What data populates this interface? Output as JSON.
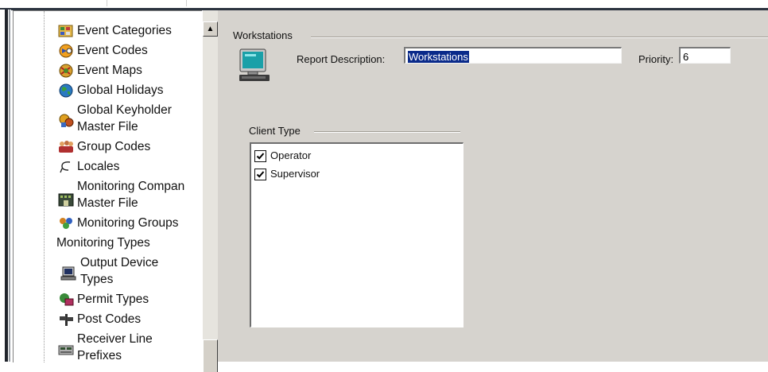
{
  "tree": {
    "items": [
      {
        "icon": "folder-tags-icon",
        "label": "Event Categories"
      },
      {
        "icon": "event-codes-icon",
        "label": "Event Codes"
      },
      {
        "icon": "event-maps-icon",
        "label": "Event Maps"
      },
      {
        "icon": "globe-icon",
        "label": "Global Holidays"
      },
      {
        "icon": "keyholder-icon",
        "label_line1": "Global Keyholder",
        "label_line2": "Master File"
      },
      {
        "icon": "group-people-icon",
        "label": "Group Codes"
      },
      {
        "icon": "locale-icon",
        "label": "Locales"
      },
      {
        "icon": "building-icon",
        "label_line1": "Monitoring Compan",
        "label_line2": "Master File"
      },
      {
        "icon": "monitoring-groups-icon",
        "label": "Monitoring Groups"
      },
      {
        "icon": "",
        "label": "Monitoring Types"
      },
      {
        "icon": "output-device-icon",
        "label_line1": "Output Device",
        "label_line2": "Types"
      },
      {
        "icon": "permit-icon",
        "label": "Permit Types"
      },
      {
        "icon": "post-codes-icon",
        "label": "Post Codes"
      },
      {
        "icon": "receiver-icon",
        "label_line1": "Receiver Line",
        "label_line2": "Prefixes"
      }
    ]
  },
  "scrollbar": {
    "up_arrow": "▲"
  },
  "main": {
    "group_title": "Workstations",
    "icon": "workstation-computer-icon",
    "report_description_label": "Report Description:",
    "report_description_value": "Workstations",
    "priority_label": "Priority:",
    "priority_value": "6",
    "client_type": {
      "title": "Client Type",
      "options": [
        {
          "label": "Operator",
          "checked": true
        },
        {
          "label": "Supervisor",
          "checked": true
        }
      ]
    }
  },
  "colors": {
    "panel": "#d6d3ce",
    "selection": "#0a2a8a",
    "frame": "#2c3440"
  }
}
